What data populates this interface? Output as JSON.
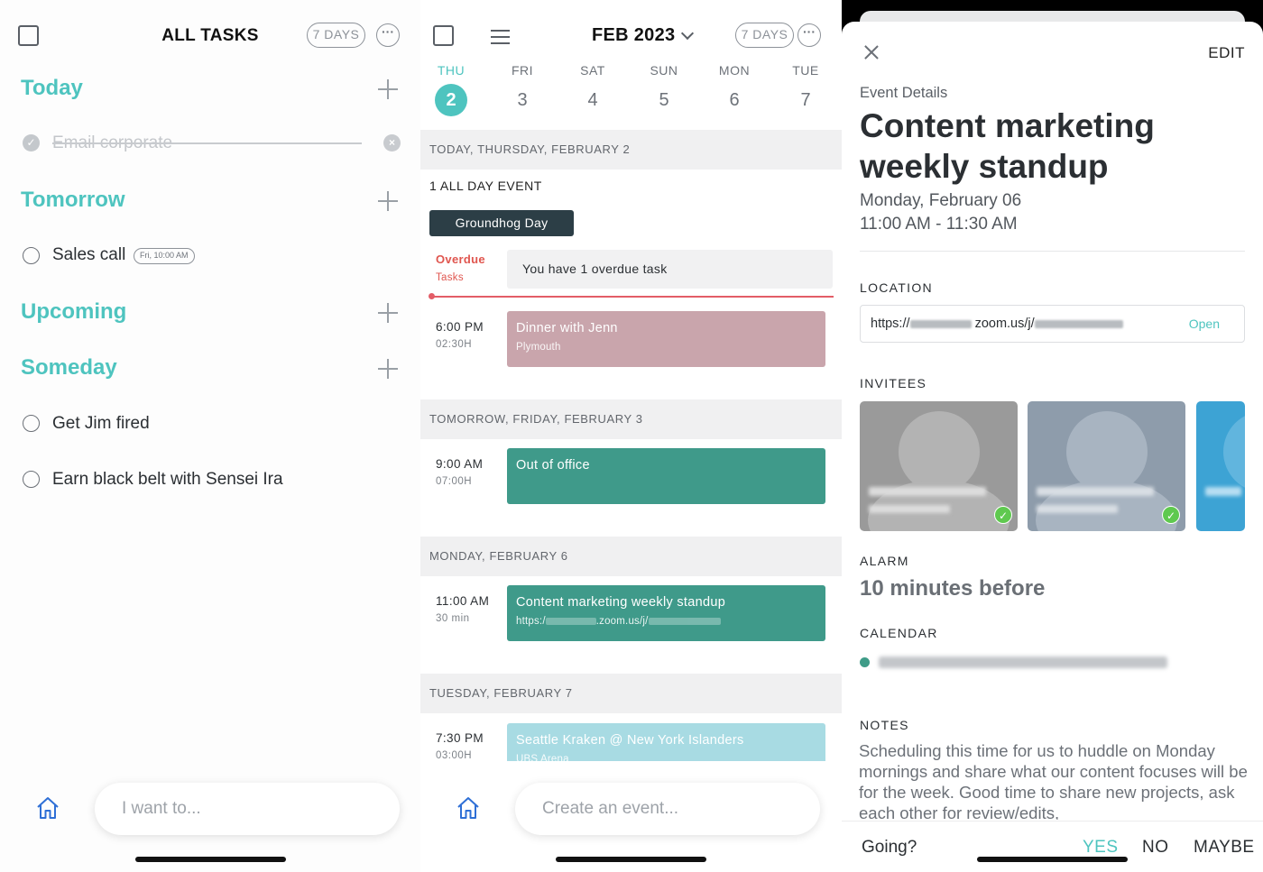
{
  "tasks": {
    "title": "ALL TASKS",
    "days_pill": "7 DAYS",
    "more_glyph": "···",
    "sections": {
      "today": "Today",
      "tomorrow": "Tomorrow",
      "upcoming": "Upcoming",
      "someday": "Someday"
    },
    "completed_task": "Email corporate",
    "tomorrow_task": "Sales call",
    "tomorrow_task_tag": "Fri, 10:00 AM",
    "someday_tasks": [
      "Get Jim fired",
      "Earn black belt with Sensei Ira"
    ],
    "input_placeholder": "I want to..."
  },
  "calendar": {
    "month": "FEB 2023",
    "days_pill": "7 DAYS",
    "more_glyph": "···",
    "days": [
      {
        "name": "THU",
        "num": "2",
        "active": true
      },
      {
        "name": "FRI",
        "num": "3"
      },
      {
        "name": "SAT",
        "num": "4"
      },
      {
        "name": "SUN",
        "num": "5"
      },
      {
        "name": "MON",
        "num": "6"
      },
      {
        "name": "TUE",
        "num": "7"
      }
    ],
    "headers": {
      "today": "TODAY, THURSDAY, FEBRUARY 2",
      "tomorrow": "TOMORROW, FRIDAY, FEBRUARY 3",
      "monday": "MONDAY, FEBRUARY 6",
      "tuesday": "TUESDAY, FEBRUARY 7"
    },
    "all_day_label": "1 ALL DAY EVENT",
    "all_day_event": "Groundhog Day",
    "overdue": {
      "label": "Overdue",
      "sub": "Tasks",
      "message": "You have 1 overdue task"
    },
    "events": {
      "dinner": {
        "time": "6:00 PM",
        "duration": "02:30H",
        "title": "Dinner with Jenn",
        "sub": "Plymouth",
        "color": "#c9a5ac"
      },
      "ooo": {
        "time": "9:00 AM",
        "duration": "07:00H",
        "title": "Out of office",
        "color": "#3f9a8a"
      },
      "standup": {
        "time": "11:00 AM",
        "duration": "30 min",
        "title": "Content marketing weekly standup",
        "sub_prefix": "https:/",
        "sub_mid": ".zoom.us/j/",
        "color": "#3f9a8a"
      },
      "kraken": {
        "time": "7:30 PM",
        "duration": "03:00H",
        "title": "Seattle Kraken @ New York Islanders",
        "sub": "UBS Arena",
        "color": "#a8dbe3"
      }
    },
    "input_placeholder": "Create an event..."
  },
  "event_details": {
    "edit_label": "EDIT",
    "section_label": "Event Details",
    "title": "Content marketing weekly standup",
    "date": "Monday, February 06",
    "time": "11:00 AM - 11:30 AM",
    "location_label": "LOCATION",
    "location_prefix": "https://",
    "location_mid": "zoom.us/j/",
    "open_label": "Open",
    "invitees_label": "INVITEES",
    "alarm_label": "ALARM",
    "alarm_value": "10 minutes before",
    "calendar_label": "CALENDAR",
    "notes_label": "NOTES",
    "notes": "Scheduling this time for us to huddle on Monday mornings and share what our content focuses will be for the week. Good time to share new projects, ask each other for review/edits,",
    "going_label": "Going?",
    "rsvp": {
      "yes": "YES",
      "no": "NO",
      "maybe": "MAYBE"
    },
    "accent": "#4ec4bf"
  }
}
